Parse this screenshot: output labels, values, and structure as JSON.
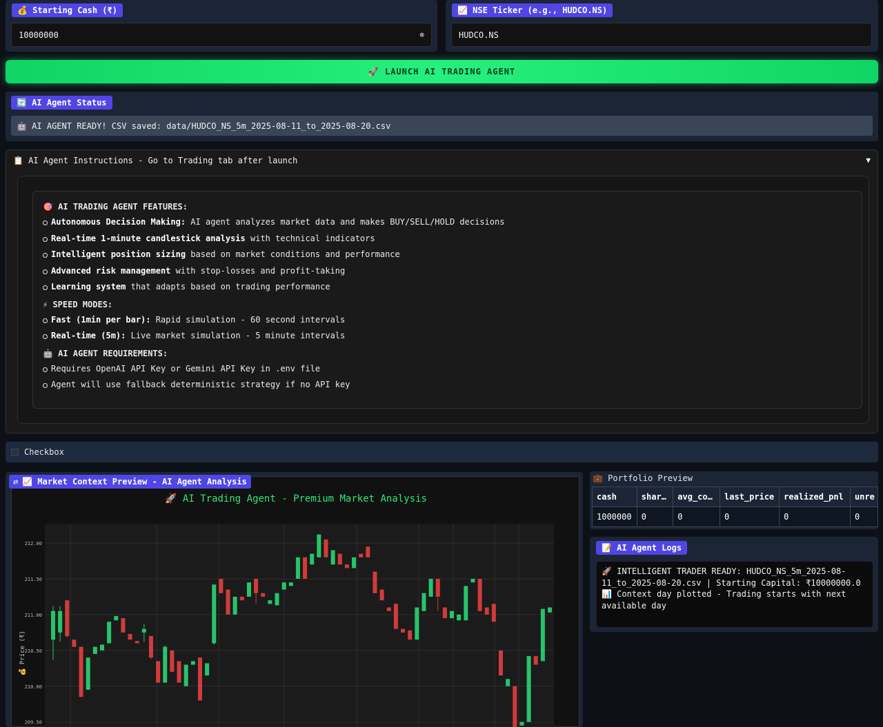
{
  "cash_section": {
    "label": "💰 Starting Cash (₹)",
    "value": "10000000",
    "clear_glyph": "⊗"
  },
  "ticker_section": {
    "label": "📈 NSE Ticker (e.g., HUDCO.NS)",
    "value": "HUDCO.NS"
  },
  "launch_button": {
    "label": "🚀 LAUNCH AI TRADING AGENT"
  },
  "agent_status": {
    "label": "🔄 AI Agent Status",
    "text": "🤖 AI AGENT READY! CSV saved: data/HUDCO_NS_5m_2025-08-11_to_2025-08-20.csv"
  },
  "instructions": {
    "header": "📋 AI Agent Instructions - Go to Trading tab after launch",
    "caret": "▼",
    "features_heading": "🎯 AI TRADING AGENT FEATURES:",
    "features": [
      {
        "bold": "Autonomous Decision Making:",
        "rest": " AI agent analyzes market data and makes BUY/SELL/HOLD decisions"
      },
      {
        "bold": "Real-time 1-minute candlestick analysis",
        "rest": " with technical indicators"
      },
      {
        "bold": "Intelligent position sizing",
        "rest": " based on market conditions and performance"
      },
      {
        "bold": "Advanced risk management",
        "rest": " with stop-losses and profit-taking"
      },
      {
        "bold": "Learning system",
        "rest": " that adapts based on trading performance"
      }
    ],
    "speed_heading": "⚡ SPEED MODES:",
    "speeds": [
      {
        "bold": "Fast (1min per bar):",
        "rest": " Rapid simulation - 60 second intervals"
      },
      {
        "bold": "Real-time (5m):",
        "rest": " Live market simulation - 5 minute intervals"
      }
    ],
    "req_heading": "🤖 AI AGENT REQUIREMENTS:",
    "requirements": [
      "Requires OpenAI API Key or Gemini API Key in .env file",
      "Agent will use fallback deterministic strategy if no API key"
    ]
  },
  "checkbox": {
    "label": "Checkbox",
    "checked": false
  },
  "market_preview": {
    "label": "📈 Market Context Preview - AI Agent Analysis",
    "corner_icon": "⇄"
  },
  "portfolio": {
    "title": "💼 Portfolio Preview",
    "headers": [
      "cash",
      "shar…",
      "avg_co…",
      "last_price",
      "realized_pnl",
      "unre"
    ],
    "row": [
      "1000000",
      "0",
      "0",
      "0",
      "0",
      "0"
    ]
  },
  "logs": {
    "label": "📝 AI Agent Logs",
    "lines": [
      "🚀 INTELLIGENT TRADER READY: HUDCO_NS_5m_2025-08-11_to_2025-08-20.csv | Starting Capital: ₹10000000.0",
      "📊 Context day plotted - Trading starts with next available day"
    ]
  },
  "chart_data": {
    "type": "candlestick",
    "title": "🚀 AI Trading Agent - Premium Market Analysis",
    "ylabel": "💰 Price (₹)",
    "yticks": [
      "212.00",
      "211.50",
      "211.00",
      "210.50",
      "210.00",
      "209.50"
    ],
    "ylim": [
      209.42,
      212.27
    ],
    "grid": true,
    "colors": {
      "up": "#27c46b",
      "down": "#d23b3b",
      "title": "#2ee67a",
      "bg": "#1b1b1b"
    },
    "candles": [
      {
        "o": 210.65,
        "c": 211.05,
        "h": 211.12,
        "l": 210.37,
        "up": true
      },
      {
        "o": 210.75,
        "c": 211.05,
        "h": 211.12,
        "l": 210.62,
        "up": true
      },
      {
        "o": 211.2,
        "c": 210.7,
        "h": 211.2,
        "l": 210.68,
        "up": false
      },
      {
        "o": 210.65,
        "c": 210.55,
        "h": 210.65,
        "l": 210.55,
        "up": false
      },
      {
        "o": 210.55,
        "c": 209.85,
        "h": 210.55,
        "l": 209.85,
        "up": false
      },
      {
        "o": 209.95,
        "c": 210.4,
        "h": 210.4,
        "l": 209.95,
        "up": true
      },
      {
        "o": 210.45,
        "c": 210.55,
        "h": 210.55,
        "l": 210.45,
        "up": true
      },
      {
        "o": 210.5,
        "c": 210.58,
        "h": 210.58,
        "l": 210.5,
        "up": true
      },
      {
        "o": 210.6,
        "c": 210.9,
        "h": 210.9,
        "l": 210.6,
        "up": true
      },
      {
        "o": 210.92,
        "c": 210.98,
        "h": 210.98,
        "l": 210.92,
        "up": true
      },
      {
        "o": 210.95,
        "c": 210.75,
        "h": 210.95,
        "l": 210.75,
        "up": false
      },
      {
        "o": 210.73,
        "c": 210.65,
        "h": 210.73,
        "l": 210.65,
        "up": false
      },
      {
        "o": 210.63,
        "c": 210.6,
        "h": 210.63,
        "l": 210.6,
        "up": false
      },
      {
        "o": 210.75,
        "c": 210.8,
        "h": 210.87,
        "l": 210.62,
        "up": true
      },
      {
        "o": 210.7,
        "c": 210.4,
        "h": 210.7,
        "l": 210.38,
        "up": false
      },
      {
        "o": 210.35,
        "c": 210.05,
        "h": 210.35,
        "l": 210.05,
        "up": false
      },
      {
        "o": 210.05,
        "c": 210.55,
        "h": 210.57,
        "l": 210.05,
        "up": true
      },
      {
        "o": 210.5,
        "c": 210.2,
        "h": 210.5,
        "l": 210.2,
        "up": false
      },
      {
        "o": 210.35,
        "c": 210.05,
        "h": 210.35,
        "l": 210.05,
        "up": false
      },
      {
        "o": 210.0,
        "c": 210.3,
        "h": 210.3,
        "l": 210.0,
        "up": true
      },
      {
        "o": 210.3,
        "c": 210.35,
        "h": 210.35,
        "l": 210.3,
        "up": true
      },
      {
        "o": 210.4,
        "c": 209.8,
        "h": 210.4,
        "l": 209.8,
        "up": false
      },
      {
        "o": 210.15,
        "c": 210.32,
        "h": 210.32,
        "l": 210.15,
        "up": true
      },
      {
        "o": 210.6,
        "c": 211.42,
        "h": 211.42,
        "l": 210.58,
        "up": true
      },
      {
        "o": 211.5,
        "c": 211.3,
        "h": 211.5,
        "l": 211.3,
        "up": false
      },
      {
        "o": 211.35,
        "c": 211.0,
        "h": 211.35,
        "l": 211.0,
        "up": false
      },
      {
        "o": 211.0,
        "c": 211.25,
        "h": 211.25,
        "l": 211.0,
        "up": true
      },
      {
        "o": 211.25,
        "c": 211.2,
        "h": 211.25,
        "l": 211.2,
        "up": false
      },
      {
        "o": 211.25,
        "c": 211.45,
        "h": 211.45,
        "l": 211.25,
        "up": true
      },
      {
        "o": 211.5,
        "c": 211.3,
        "h": 211.5,
        "l": 211.15,
        "up": false
      },
      {
        "o": 211.3,
        "c": 211.25,
        "h": 211.3,
        "l": 211.25,
        "up": false
      },
      {
        "o": 211.15,
        "c": 211.2,
        "h": 211.2,
        "l": 211.15,
        "up": true
      },
      {
        "o": 211.13,
        "c": 211.3,
        "h": 211.3,
        "l": 211.13,
        "up": true
      },
      {
        "o": 211.35,
        "c": 211.45,
        "h": 211.45,
        "l": 211.35,
        "up": true
      },
      {
        "o": 211.4,
        "c": 211.45,
        "h": 211.45,
        "l": 211.4,
        "up": true
      },
      {
        "o": 211.5,
        "c": 211.8,
        "h": 211.8,
        "l": 211.5,
        "up": true
      },
      {
        "o": 211.8,
        "c": 211.5,
        "h": 211.8,
        "l": 211.5,
        "up": false
      },
      {
        "o": 211.7,
        "c": 211.85,
        "h": 211.85,
        "l": 211.7,
        "up": true
      },
      {
        "o": 211.8,
        "c": 212.12,
        "h": 212.12,
        "l": 211.8,
        "up": true
      },
      {
        "o": 212.05,
        "c": 211.8,
        "h": 212.05,
        "l": 211.8,
        "up": false
      },
      {
        "o": 211.7,
        "c": 211.9,
        "h": 211.9,
        "l": 211.7,
        "up": true
      },
      {
        "o": 211.85,
        "c": 211.7,
        "h": 211.85,
        "l": 211.7,
        "up": false
      },
      {
        "o": 211.7,
        "c": 211.65,
        "h": 211.7,
        "l": 211.65,
        "up": false
      },
      {
        "o": 211.65,
        "c": 211.8,
        "h": 211.8,
        "l": 211.65,
        "up": true
      },
      {
        "o": 211.85,
        "c": 211.8,
        "h": 211.85,
        "l": 211.8,
        "up": false
      },
      {
        "o": 211.95,
        "c": 211.8,
        "h": 211.95,
        "l": 211.8,
        "up": false
      },
      {
        "o": 211.6,
        "c": 211.3,
        "h": 211.6,
        "l": 211.3,
        "up": false
      },
      {
        "o": 211.35,
        "c": 211.2,
        "h": 211.35,
        "l": 211.2,
        "up": false
      },
      {
        "o": 211.1,
        "c": 211.05,
        "h": 211.1,
        "l": 211.05,
        "up": false
      },
      {
        "o": 211.15,
        "c": 210.8,
        "h": 211.15,
        "l": 210.8,
        "up": false
      },
      {
        "o": 210.8,
        "c": 210.75,
        "h": 210.8,
        "l": 210.75,
        "up": false
      },
      {
        "o": 210.78,
        "c": 210.65,
        "h": 210.78,
        "l": 210.65,
        "up": false
      },
      {
        "o": 210.65,
        "c": 211.1,
        "h": 211.1,
        "l": 210.65,
        "up": true
      },
      {
        "o": 211.05,
        "c": 211.3,
        "h": 211.3,
        "l": 211.05,
        "up": true
      },
      {
        "o": 211.25,
        "c": 211.5,
        "h": 211.5,
        "l": 211.25,
        "up": true
      },
      {
        "o": 211.5,
        "c": 211.25,
        "h": 211.5,
        "l": 211.05,
        "up": false
      },
      {
        "o": 211.1,
        "c": 210.95,
        "h": 211.1,
        "l": 210.95,
        "up": false
      },
      {
        "o": 210.95,
        "c": 211.05,
        "h": 211.05,
        "l": 210.95,
        "up": true
      },
      {
        "o": 211.0,
        "c": 210.92,
        "h": 211.0,
        "l": 210.92,
        "up": true
      },
      {
        "o": 210.92,
        "c": 211.4,
        "h": 211.4,
        "l": 210.92,
        "up": true
      },
      {
        "o": 211.45,
        "c": 211.5,
        "h": 211.5,
        "l": 211.45,
        "up": true
      },
      {
        "o": 211.5,
        "c": 211.05,
        "h": 211.5,
        "l": 211.05,
        "up": false
      },
      {
        "o": 211.1,
        "c": 211.0,
        "h": 211.1,
        "l": 211.0,
        "up": false
      },
      {
        "o": 211.15,
        "c": 210.9,
        "h": 211.15,
        "l": 210.9,
        "up": false
      },
      {
        "o": 210.5,
        "c": 210.15,
        "h": 210.5,
        "l": 210.15,
        "up": false
      },
      {
        "o": 210.1,
        "c": 210.0,
        "h": 210.1,
        "l": 210.0,
        "up": true
      },
      {
        "o": 210.0,
        "c": 209.42,
        "h": 210.0,
        "l": 209.42,
        "up": false
      },
      {
        "o": 209.45,
        "c": 209.5,
        "h": 209.5,
        "l": 209.45,
        "up": true
      },
      {
        "o": 209.5,
        "c": 210.42,
        "h": 210.42,
        "l": 209.5,
        "up": true
      },
      {
        "o": 210.42,
        "c": 210.3,
        "h": 210.42,
        "l": 210.3,
        "up": false
      },
      {
        "o": 210.35,
        "c": 211.08,
        "h": 211.08,
        "l": 210.35,
        "up": true
      },
      {
        "o": 211.03,
        "c": 211.1,
        "h": 211.1,
        "l": 211.03,
        "up": true
      }
    ]
  }
}
